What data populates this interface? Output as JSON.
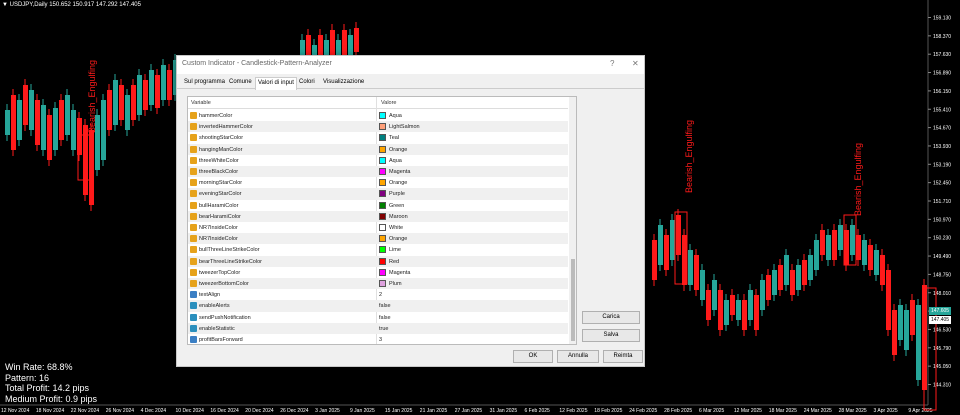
{
  "chart": {
    "symbol_line": "USDJPY,Daily  150.652 150.917 147.292 147.405",
    "price_labels": [
      "159.130",
      "158.370",
      "157.630",
      "156.890",
      "156.150",
      "155.410",
      "154.670",
      "153.930",
      "153.190",
      "152.450",
      "151.710",
      "150.970",
      "150.230",
      "149.490",
      "148.750",
      "148.010",
      "147.270",
      "146.530",
      "145.790",
      "145.050",
      "144.310"
    ],
    "price_tag_green": "147.605",
    "price_tag_white": "147.405",
    "date_labels": [
      "12 Nov 2024",
      "18 Nov 2024",
      "22 Nov 2024",
      "26 Nov 2024",
      "4 Dec 2024",
      "10 Dec 2024",
      "16 Dec 2024",
      "20 Dec 2024",
      "26 Dec 2024",
      "3 Jan 2025",
      "9 Jan 2025",
      "15 Jan 2025",
      "21 Jan 2025",
      "27 Jan 2025",
      "31 Jan 2025",
      "6 Feb 2025",
      "12 Feb 2025",
      "18 Feb 2025",
      "24 Feb 2025",
      "28 Feb 2025",
      "6 Mar 2025",
      "12 Mar 2025",
      "18 Mar 2025",
      "24 Mar 2025",
      "28 Mar 2025",
      "3 Apr 2025",
      "9 Apr 2025"
    ],
    "pattern_labels": [
      "Bearish_Engulfing",
      "Bearish_Engulfing",
      "Bearish_Engulfing"
    ],
    "colors": {
      "bull": "#26a69a",
      "bear": "#ff1a1a",
      "background": "#000000"
    }
  },
  "stats": {
    "win_rate": "Win Rate: 68.8%",
    "pattern": "Pattern: 16",
    "total_profit": "Total Profit: 14.2 pips",
    "medium_profit": "Medium Profit: 0.9 pips"
  },
  "dialog": {
    "title": "Custom Indicator - Candlestick-Pattern-Analyzer",
    "help": "?",
    "close": "✕",
    "tabs": [
      "Sul programma",
      "Comune",
      "Valori di input",
      "Colori",
      "Visualizzazione"
    ],
    "active_tab": 2,
    "col_variable": "Variable",
    "col_value": "Valore",
    "rows": [
      {
        "name": "hammerColor",
        "value": "Aqua",
        "swatch": "#00ffff",
        "icon": "color"
      },
      {
        "name": "invertedHammerColor",
        "value": "LightSalmon",
        "swatch": "#ffa07a",
        "icon": "color"
      },
      {
        "name": "shootingStarColor",
        "value": "Teal",
        "swatch": "#008080",
        "icon": "color"
      },
      {
        "name": "hangingManColor",
        "value": "Orange",
        "swatch": "#ffa500",
        "icon": "color"
      },
      {
        "name": "threeWhiteColor",
        "value": "Aqua",
        "swatch": "#00ffff",
        "icon": "color"
      },
      {
        "name": "threeBlackColor",
        "value": "Magenta",
        "swatch": "#ff00ff",
        "icon": "color"
      },
      {
        "name": "morningStarColor",
        "value": "Orange",
        "swatch": "#ffa500",
        "icon": "color"
      },
      {
        "name": "eveningStarColor",
        "value": "Purple",
        "swatch": "#800080",
        "icon": "color"
      },
      {
        "name": "bullHaramiColor",
        "value": "Green",
        "swatch": "#008000",
        "icon": "color"
      },
      {
        "name": "bearHaramiColor",
        "value": "Maroon",
        "swatch": "#800000",
        "icon": "color"
      },
      {
        "name": "NR7InsideColor",
        "value": "White",
        "swatch": "#ffffff",
        "icon": "color"
      },
      {
        "name": "NR7InsideColor",
        "value": "Orange",
        "swatch": "#ffa500",
        "icon": "color"
      },
      {
        "name": "bullThreeLineStrikeColor",
        "value": "Lime",
        "swatch": "#00ff00",
        "icon": "color"
      },
      {
        "name": "bearThreeLineStrikeColor",
        "value": "Red",
        "swatch": "#ff0000",
        "icon": "color"
      },
      {
        "name": "tweezerTopColor",
        "value": "Magenta",
        "swatch": "#ff00ff",
        "icon": "color"
      },
      {
        "name": "tweezerBottomColor",
        "value": "Plum",
        "swatch": "#dda0dd",
        "icon": "color"
      },
      {
        "name": "textAlign",
        "value": "2",
        "swatch": "",
        "icon": "int"
      },
      {
        "name": "enableAlerts",
        "value": "false",
        "swatch": "",
        "icon": "bool"
      },
      {
        "name": "sendPushNotification",
        "value": "false",
        "swatch": "",
        "icon": "bool"
      },
      {
        "name": "enableStatistic",
        "value": "true",
        "swatch": "",
        "icon": "bool"
      },
      {
        "name": "profitBarsForward",
        "value": "3",
        "swatch": "",
        "icon": "int"
      }
    ],
    "load_button": "Carica",
    "save_button": "Salva",
    "ok_button": "OK",
    "cancel_button": "Annulla",
    "reset_button": "Reimta"
  }
}
